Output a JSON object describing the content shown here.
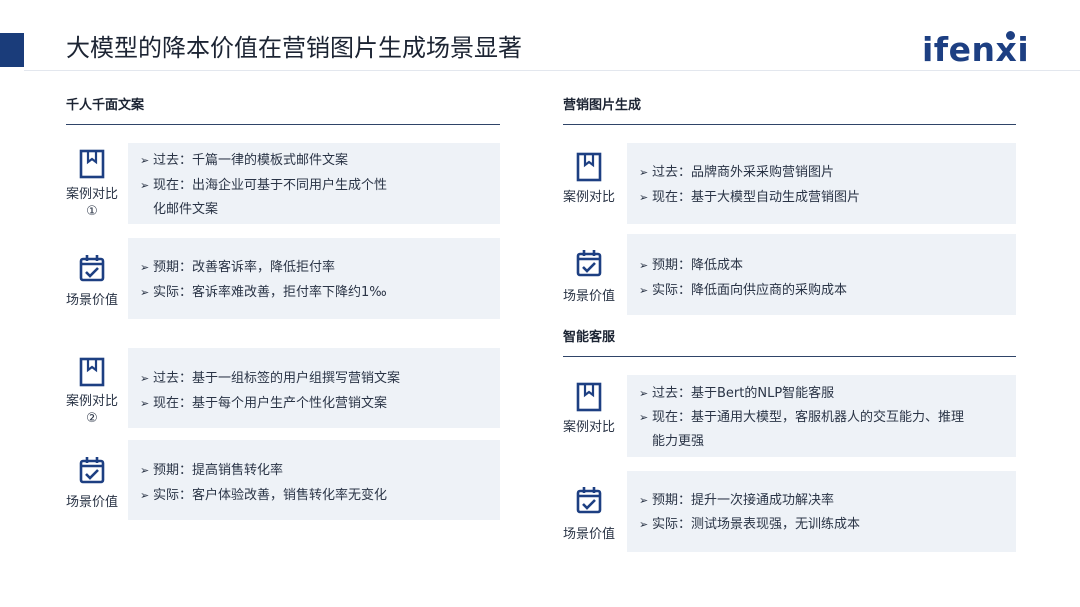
{
  "title": "大模型的降本价值在营销图片生成场景显著",
  "logo": "ifenxi",
  "left": {
    "heading": "千人千面文案",
    "case1": {
      "label": "案例对比",
      "num": "①",
      "lines": [
        "过去：千篇一律的模板式邮件文案",
        "现在：出海企业可基于不同用户生成个性",
        "化邮件文案"
      ]
    },
    "value1": {
      "label": "场景价值",
      "lines": [
        "预期：改善客诉率，降低拒付率",
        "实际：客诉率难改善，拒付率下降约1‰"
      ]
    },
    "case2": {
      "label": "案例对比",
      "num": "②",
      "lines": [
        "过去：基于一组标签的用户组撰写营销文案",
        "现在：基于每个用户生产个性化营销文案"
      ]
    },
    "value2": {
      "label": "场景价值",
      "lines": [
        "预期：提高销售转化率",
        "实际：客户体验改善，销售转化率无变化"
      ]
    }
  },
  "right": {
    "heading1": "营销图片生成",
    "case1": {
      "label": "案例对比",
      "lines": [
        "过去：品牌商外采采购营销图片",
        "现在：基于大模型自动生成营销图片"
      ]
    },
    "value1": {
      "label": "场景价值",
      "lines": [
        "预期：降低成本",
        "实际：降低面向供应商的采购成本"
      ]
    },
    "heading2": "智能客服",
    "case2": {
      "label": "案例对比",
      "lines": [
        "过去：基于Bert的NLP智能客服",
        "现在：基于通用大模型，客服机器人的交互能力、推理",
        "能力更强"
      ]
    },
    "value2": {
      "label": "场景价值",
      "lines": [
        "预期：提升一次接通成功解决率",
        "实际：测试场景表现强，无训练成本"
      ]
    }
  },
  "icons": {
    "case": "bookmark-icon",
    "value": "calendar-check-icon"
  },
  "colors": {
    "brand": "#1d3f82",
    "card": "#eef2f7",
    "text": "#2a3446"
  }
}
